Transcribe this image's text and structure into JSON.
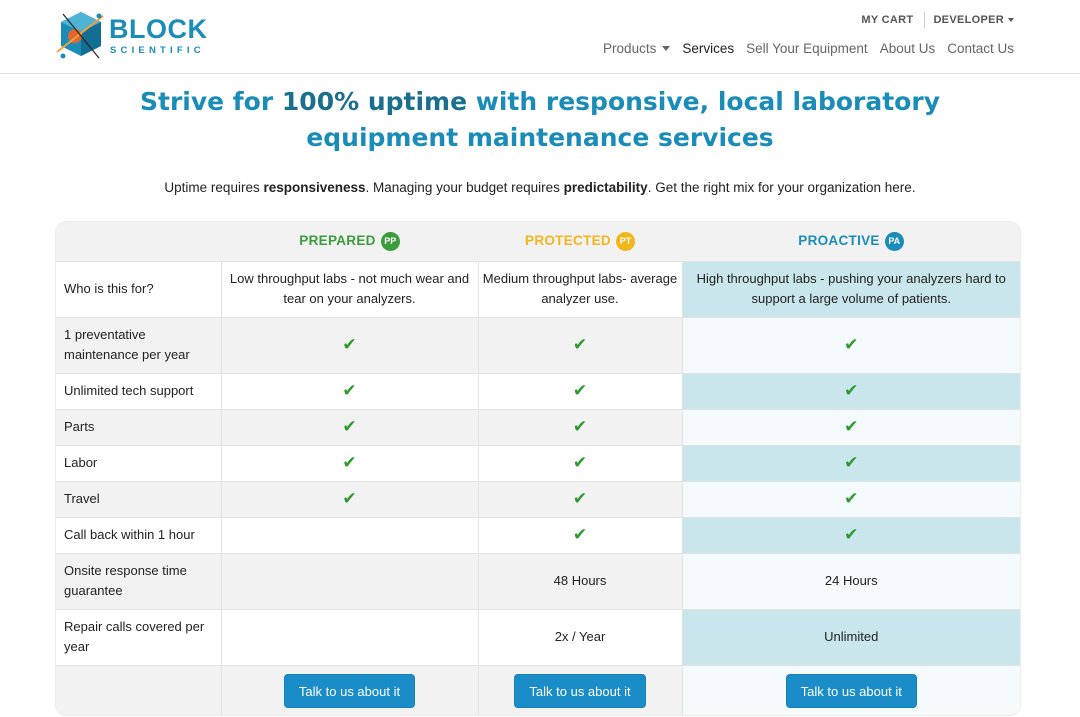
{
  "brand": {
    "name_top": "BLOCK",
    "name_bottom": "SCIENTIFIC"
  },
  "top_links": {
    "cart": "MY CART",
    "user": "DEVELOPER"
  },
  "nav": [
    {
      "label": "Products",
      "has_dropdown": true,
      "active": false
    },
    {
      "label": "Services",
      "has_dropdown": false,
      "active": true
    },
    {
      "label": "Sell Your Equipment",
      "has_dropdown": false,
      "active": false
    },
    {
      "label": "About Us",
      "has_dropdown": false,
      "active": false
    },
    {
      "label": "Contact Us",
      "has_dropdown": false,
      "active": false
    }
  ],
  "hero": {
    "title_pre": "Strive for ",
    "title_bold": "100% uptime",
    "title_post": " with responsive, local laboratory equipment maintenance  services",
    "sub_1": "Uptime requires ",
    "sub_bold_1": "responsiveness",
    "sub_2": ". Managing your budget requires ",
    "sub_bold_2": "predictability",
    "sub_3": ". Get the right mix for your organization here."
  },
  "plans": [
    {
      "name": "PREPARED",
      "badge": "PP",
      "color": "#3c9b3c"
    },
    {
      "name": "PROTECTED",
      "badge": "PT",
      "color": "#f2b51c"
    },
    {
      "name": "PROACTIVE",
      "badge": "PA",
      "color": "#1a8cb8"
    }
  ],
  "rows": {
    "who": {
      "label": "Who is this for?",
      "pp": "Low throughput labs - not much wear and tear on your analyzers.",
      "pt": "Medium throughput labs- average analyzer use.",
      "pa": "High throughput labs - pushing your analyzers hard to support a large volume of patients."
    },
    "pm": {
      "label": "1 preventative maintenance per year",
      "pp": "✔",
      "pt": "✔",
      "pa": "✔"
    },
    "support": {
      "label": "Unlimited tech support",
      "pp": "✔",
      "pt": "✔",
      "pa": "✔"
    },
    "parts": {
      "label": "Parts",
      "pp": "✔",
      "pt": "✔",
      "pa": "✔"
    },
    "labor": {
      "label": "Labor",
      "pp": "✔",
      "pt": "✔",
      "pa": "✔"
    },
    "travel": {
      "label": "Travel",
      "pp": "✔",
      "pt": "✔",
      "pa": "✔"
    },
    "callback": {
      "label": "Call back within 1 hour",
      "pp": "",
      "pt": "✔",
      "pa": "✔"
    },
    "onsite": {
      "label": "Onsite response time guarantee",
      "pp": "",
      "pt": "48 Hours",
      "pa": "24 Hours"
    },
    "repair": {
      "label": "Repair calls covered per year",
      "pp": "",
      "pt": "2x / Year",
      "pa": "Unlimited"
    }
  },
  "cta": {
    "label": "Talk to us about it"
  },
  "colors": {
    "accent": "#1a8cb8",
    "button": "#1a8cc8",
    "check": "#2e9a2e",
    "proactive_highlight": "#c8e6ec"
  }
}
